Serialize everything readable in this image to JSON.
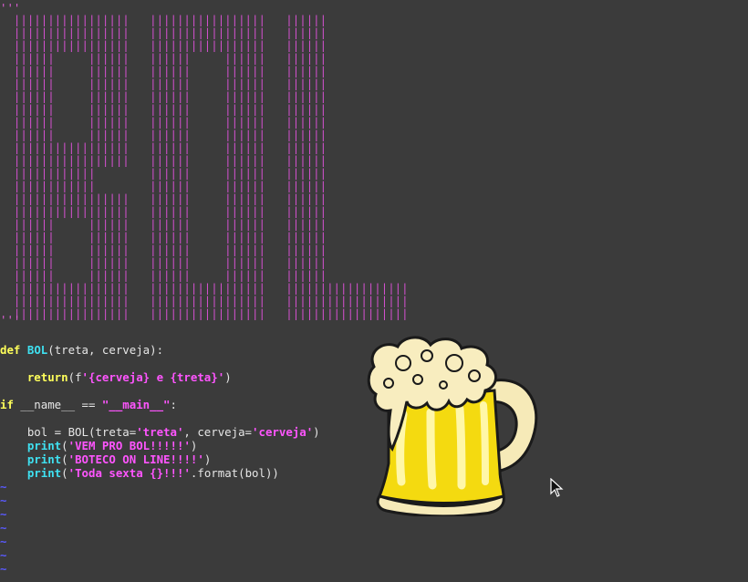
{
  "editor": {
    "docstring_open": "'''",
    "docstring_close": "'''",
    "ascii_art_rows": [
      "  |||||||||||||||||   |||||||||||||||||   ||||||",
      "  |||||||||||||||||   |||||||||||||||||   ||||||",
      "  |||||||||||||||||   |||||||||||||||||   ||||||",
      "  ||||||     ||||||   ||||||     ||||||   ||||||",
      "  ||||||     ||||||   ||||||     ||||||   ||||||",
      "  ||||||     ||||||   ||||||     ||||||   ||||||",
      "  ||||||     ||||||   ||||||     ||||||   ||||||",
      "  ||||||     ||||||   ||||||     ||||||   ||||||",
      "  ||||||     ||||||   ||||||     ||||||   ||||||",
      "  ||||||     ||||||   ||||||     ||||||   ||||||",
      "  |||||||||||||||||   ||||||     ||||||   ||||||",
      "  |||||||||||||||||   ||||||     ||||||   ||||||",
      "  ||||||||||||        ||||||     ||||||   ||||||",
      "  ||||||||||||        ||||||     ||||||   ||||||",
      "  |||||||||||||||||   ||||||     ||||||   ||||||",
      "  |||||||||||||||||   ||||||     ||||||   ||||||",
      "  ||||||     ||||||   ||||||     ||||||   ||||||",
      "  ||||||     ||||||   ||||||     ||||||   ||||||",
      "  ||||||     ||||||   ||||||     ||||||   ||||||",
      "  ||||||     ||||||   ||||||     ||||||   ||||||",
      "  ||||||     ||||||   ||||||     ||||||   ||||||",
      "  |||||||||||||||||   |||||||||||||||||   ||||||||||||||||||",
      "  |||||||||||||||||   |||||||||||||||||   ||||||||||||||||||",
      "  |||||||||||||||||   |||||||||||||||||   ||||||||||||||||||"
    ],
    "code": {
      "def_kw": "def",
      "func_name": "BOL",
      "def_params": "(treta, cerveja):",
      "return_indent": "    ",
      "return_kw": "return",
      "return_open": "(f",
      "return_str": "'{cerveja} e {treta}'",
      "return_close": ")",
      "if_kw": "if",
      "if_cond": " __name__ == ",
      "main_str": "\"__main__\"",
      "if_colon": ":",
      "assign_prefix": "    bol = BOL(treta=",
      "treta_str": "'treta'",
      "assign_mid": ", cerveja=",
      "cerveja_str": "'cerveja'",
      "assign_close": ")",
      "print_kw": "print",
      "print1_str": "'VEM PRO BOL!!!!!'",
      "print2_str": "'BOTECO ON LINE!!!!'",
      "print3_str": "'Toda sexta {}!!!'",
      "print3_tail": ".format(bol))",
      "paren_open": "(",
      "paren_close": ")",
      "indent": "    "
    },
    "tilde": "~"
  },
  "colors": {
    "background": "#3b3b3b",
    "ascii_art": "#d050cc",
    "keyword": "#ffff5a",
    "function": "#3fe0f0",
    "string": "#ff55ff",
    "tilde": "#5a5aff"
  },
  "icons": {
    "beer": "beer-mug-icon",
    "cursor": "mouse-pointer-icon"
  }
}
